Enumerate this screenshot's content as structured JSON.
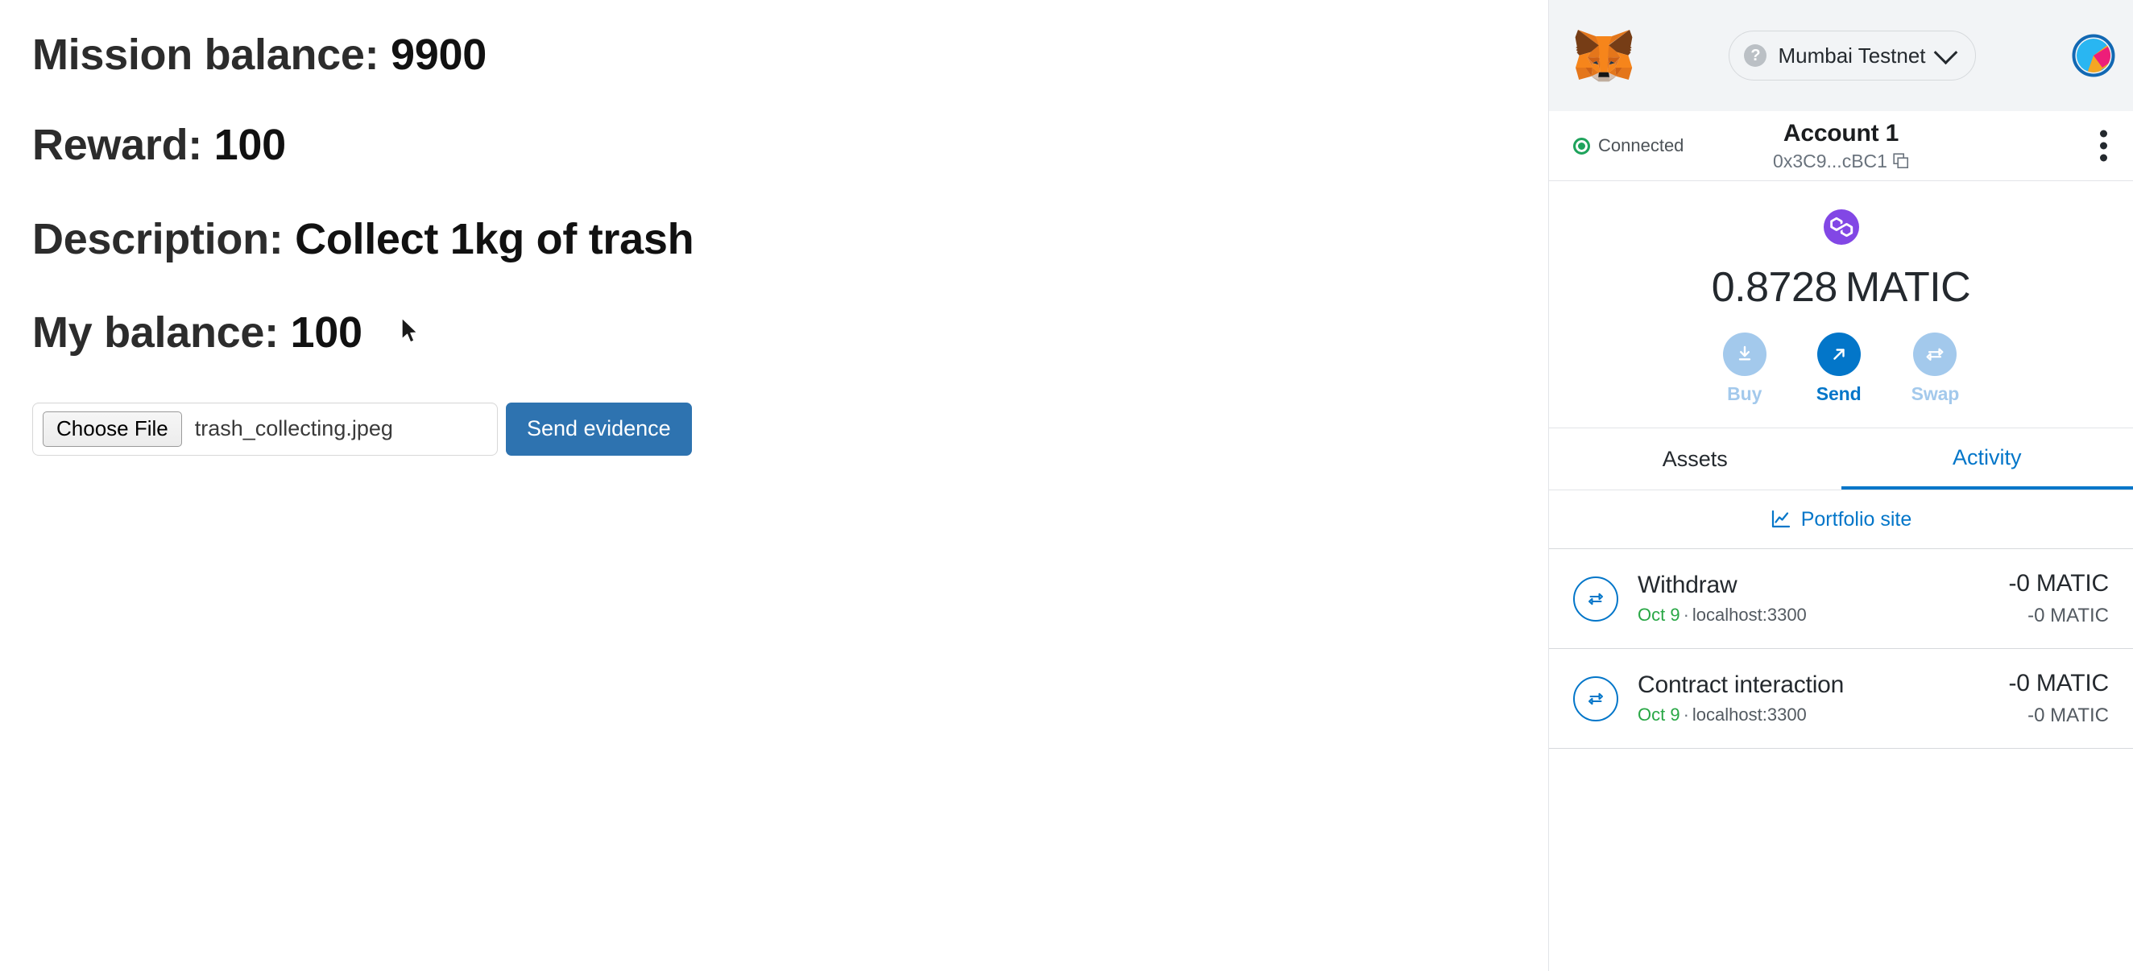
{
  "dapp": {
    "lines": [
      {
        "label": "Mission balance: ",
        "value": "9900"
      },
      {
        "label": "Reward: ",
        "value": "100"
      },
      {
        "label": "Description: ",
        "value": "Collect 1kg of trash"
      },
      {
        "label": "My balance: ",
        "value": "100"
      }
    ],
    "file_input": {
      "button_label": "Choose File",
      "file_name": "trash_collecting.jpeg"
    },
    "submit_label": "Send evidence"
  },
  "metamask": {
    "header": {
      "network_name": "Mumbai Testnet",
      "network_unknown_glyph": "?"
    },
    "account": {
      "connected_label": "Connected",
      "name": "Account 1",
      "address": "0x3C9...cBC1"
    },
    "balance": {
      "amount": "0.8728",
      "unit": "MATIC"
    },
    "actions": [
      {
        "label": "Buy",
        "icon": "download-icon",
        "state": "disabled"
      },
      {
        "label": "Send",
        "icon": "arrow-up-right-icon",
        "state": "active"
      },
      {
        "label": "Swap",
        "icon": "swap-icon",
        "state": "disabled"
      }
    ],
    "tabs": [
      {
        "label": "Assets",
        "active": false
      },
      {
        "label": "Activity",
        "active": true
      }
    ],
    "portfolio": {
      "label": "Portfolio site",
      "icon": "chart-line-icon"
    },
    "activity": [
      {
        "title": "Withdraw",
        "date": "Oct 9",
        "separator": "·",
        "origin": "localhost:3300",
        "amount": "-0 MATIC",
        "fiat": "-0 MATIC",
        "icon": "swap-circle-icon"
      },
      {
        "title": "Contract interaction",
        "date": "Oct 9",
        "separator": "·",
        "origin": "localhost:3300",
        "amount": "-0 MATIC",
        "fiat": "-0 MATIC",
        "icon": "swap-circle-icon"
      }
    ]
  },
  "colors": {
    "accent_blue": "#0376c9",
    "accent_blue_muted": "#a3c9ec",
    "polygon_purple": "#8247e5",
    "connected_green": "#1fa35c",
    "date_green": "#28a745",
    "button_blue": "#2e73b0",
    "header_bg": "#f2f4f6",
    "border": "#e2e4e8"
  }
}
